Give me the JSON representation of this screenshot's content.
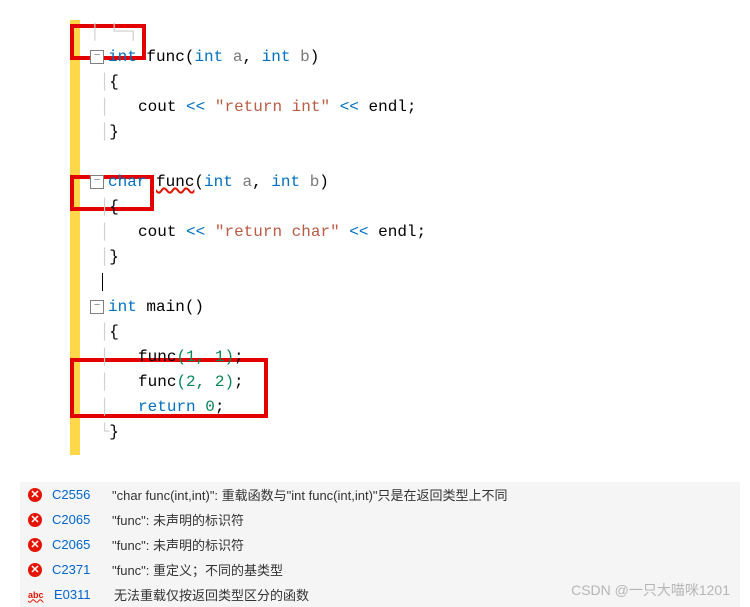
{
  "code": {
    "kw_int": "int",
    "kw_char": "char",
    "kw_return": "return",
    "func_name": "func",
    "main_name": "main",
    "param_a": "a",
    "param_b": "b",
    "cout": "cout",
    "endl": "endl",
    "str_return_int": "\"return int\"",
    "str_return_char": "\"return char\"",
    "call1_args": "(1, 1)",
    "call2_args": "(2, 2)",
    "zero": "0",
    "fold_minus": "−"
  },
  "errors": [
    {
      "icon": "x",
      "code": "C2556",
      "msg": "\"char func(int,int)\": 重载函数与\"int func(int,int)\"只是在返回类型上不同"
    },
    {
      "icon": "x",
      "code": "C2065",
      "msg": "\"func\": 未声明的标识符"
    },
    {
      "icon": "x",
      "code": "C2065",
      "msg": "\"func\": 未声明的标识符"
    },
    {
      "icon": "x",
      "code": "C2371",
      "msg": "\"func\": 重定义；不同的基类型"
    },
    {
      "icon": "abc",
      "code": "E0311",
      "msg": "无法重载仅按返回类型区分的函数"
    }
  ],
  "watermark": "CSDN @一只大喵咪1201"
}
